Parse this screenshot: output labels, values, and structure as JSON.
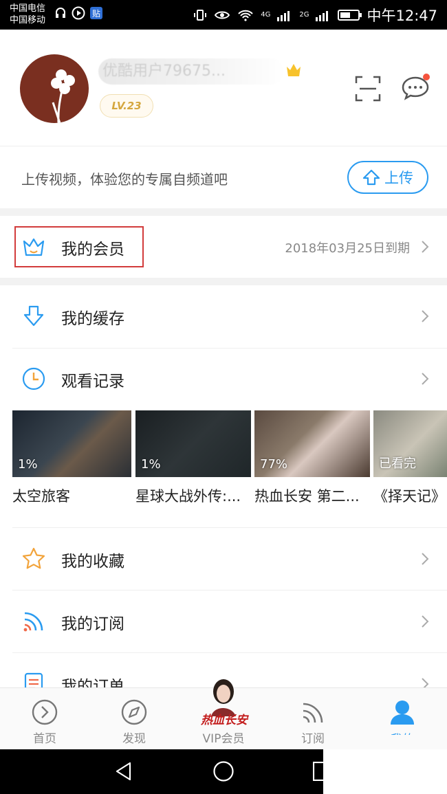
{
  "status_bar": {
    "carrier_1": "中国电信",
    "carrier_2": "中国移动",
    "net_1": "4G",
    "net_2": "2G",
    "time": "中午12:47",
    "battery_level": 0.6
  },
  "profile": {
    "username": "优酷用户79675...",
    "level": "LV.23"
  },
  "upload": {
    "prompt": "上传视频，体验您的专属自频道吧",
    "button_label": "上传"
  },
  "membership": {
    "label": "我的会员",
    "expiry": "2018年03月25日到期"
  },
  "menu": {
    "cache": "我的缓存",
    "history": "观看记录",
    "favorites": "我的收藏",
    "subscriptions": "我的订阅",
    "orders": "我的订单"
  },
  "history_items": [
    {
      "title": "太空旅客",
      "progress": "1%"
    },
    {
      "title": "星球大战外传:...",
      "progress": "1%"
    },
    {
      "title": "热血长安 第二...",
      "progress": "77%"
    },
    {
      "title": "《择天记》",
      "progress": "已看完"
    }
  ],
  "tabs": {
    "home": "首页",
    "discover": "发现",
    "vip": "VIP会员",
    "subscribe": "订阅",
    "me": "我的"
  },
  "promo_text": "热血长安",
  "colors": {
    "accent_blue": "#2a9bf0",
    "highlight_red": "#d23b3b",
    "vip_gold": "#d5a73f",
    "star_orange": "#f2a33a",
    "rss_red": "#f06a4a"
  }
}
